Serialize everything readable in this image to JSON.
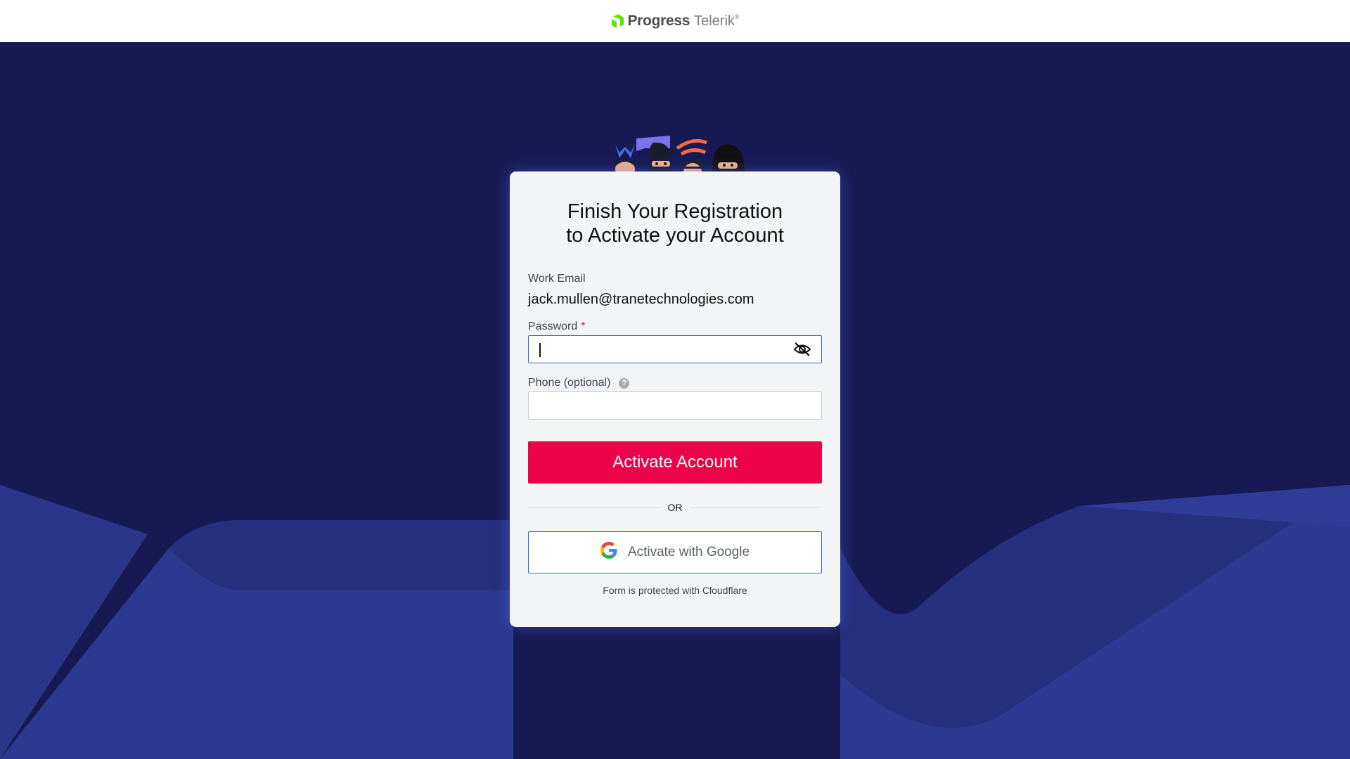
{
  "header": {
    "brand_name": "Progress",
    "product_name": "Telerik",
    "trademark": "®",
    "logo_icon": "progress-logo-icon",
    "brand_color": "#5ce500"
  },
  "hero": {
    "illustration_icon": "ninja-mascots-illustration"
  },
  "form": {
    "title_line1": "Finish Your Registration",
    "title_line2": "to Activate your Account",
    "email_label": "Work Email",
    "email_value": "jack.mullen@tranetechnologies.com",
    "password_label": "Password",
    "password_required_marker": "*",
    "password_value": "",
    "password_visibility_icon": "eye-slash-icon",
    "phone_label": "Phone (optional)",
    "phone_help_glyph": "?",
    "phone_help_icon": "question-circle-icon",
    "phone_value": "",
    "submit_label": "Activate Account",
    "divider_label": "OR",
    "google_label": "Activate with Google",
    "google_icon": "google-g-icon",
    "footnote": "Form is protected with Cloudflare"
  },
  "colors": {
    "primary_button": "#eb0249",
    "background_dark": "#171a52",
    "background_wave": "#2b3990",
    "focus_border": "#3b63d8",
    "required_star": "#e8112d"
  }
}
